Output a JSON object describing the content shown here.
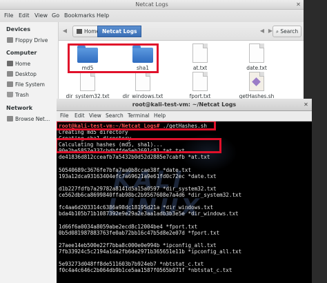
{
  "file_manager": {
    "title": "Netcat Logs",
    "menu": [
      "File",
      "Edit",
      "View",
      "Go",
      "Bookmarks",
      "Help"
    ],
    "sidebar": {
      "devices_heading": "Devices",
      "devices": [
        "Floppy Drive"
      ],
      "computer_heading": "Computer",
      "computer": [
        "Home",
        "Desktop",
        "File System",
        "Trash"
      ],
      "network_heading": "Network",
      "network": [
        "Browse Net…"
      ]
    },
    "toolbar": {
      "crumb_home": "Home",
      "crumb_active": "Netcat Logs",
      "search_label": "Search"
    },
    "files": [
      {
        "name": "md5",
        "type": "folder"
      },
      {
        "name": "sha1",
        "type": "folder"
      },
      {
        "name": "at.txt",
        "type": "document"
      },
      {
        "name": "date.txt",
        "type": "document"
      },
      {
        "name": "dir_system32.txt",
        "type": "document"
      },
      {
        "name": "dir_windows.txt",
        "type": "document"
      },
      {
        "name": "fport.txt",
        "type": "document"
      },
      {
        "name": "getHashes.sh",
        "type": "script"
      }
    ],
    "highlight_color": "#e0102a"
  },
  "terminal": {
    "title": "root@kali-test-vm: ~/Netcat Logs",
    "menu": [
      "File",
      "Edit",
      "View",
      "Search",
      "Terminal",
      "Help"
    ],
    "prompt": "root@kali-test-vm:~/Netcat Logs#",
    "command": " ./getHashes.sh",
    "watermark": "KALI LINUX",
    "lines": [
      "Creating md5 directory",
      "Creating sha1 directory",
      "Calculating hashes (md5, sha1)...",
      "90e2be5857e337cbdbffde5eb2691c81  *at.txt",
      "de41836d812cceafb7a5432b0d52d2885e7cabfb  *at.txt",
      "",
      "50540689c3676fe7bfa7aa0b8ccae38f  *date.txt",
      "193a12dca93163404efc7a69621a9e61fd0c72ec  *date.txt",
      "",
      "d1b227fdfb7a29782a8141d5a15a0597  *dir_system32.txt",
      "ce562db6ca8699840ffab98bc2b9567608e7a4d6  *dir_system32.txt",
      "",
      "fc4aa6d203314c6386a98dc18195d21a  *dir_windows.txt",
      "bda4b105b71b1087392e9e29a2e3aa1adb3b3e5e  *dir_windows.txt",
      "",
      "1d66f6a0034a8059abe2ecd8c12004be4  *fport.txt",
      "0b5d081987883763fe0ab72bb16c47b5d8e2e07d  *fport.txt",
      "",
      "27aee14eb500e22f7bba8c000e0e994b  *ipconfig_all.txt",
      "7fb33924c5c2194a1da2fb6de2971b365651e11b  *ipconfig_all.txt",
      "",
      "5e93273d048ff8de511603b7b924eb7  *nbtstat_c.txt",
      "f0c4a4c646c2b064db9b1ce5aa1587f0565b071f  *nbtstat_c.txt"
    ]
  }
}
